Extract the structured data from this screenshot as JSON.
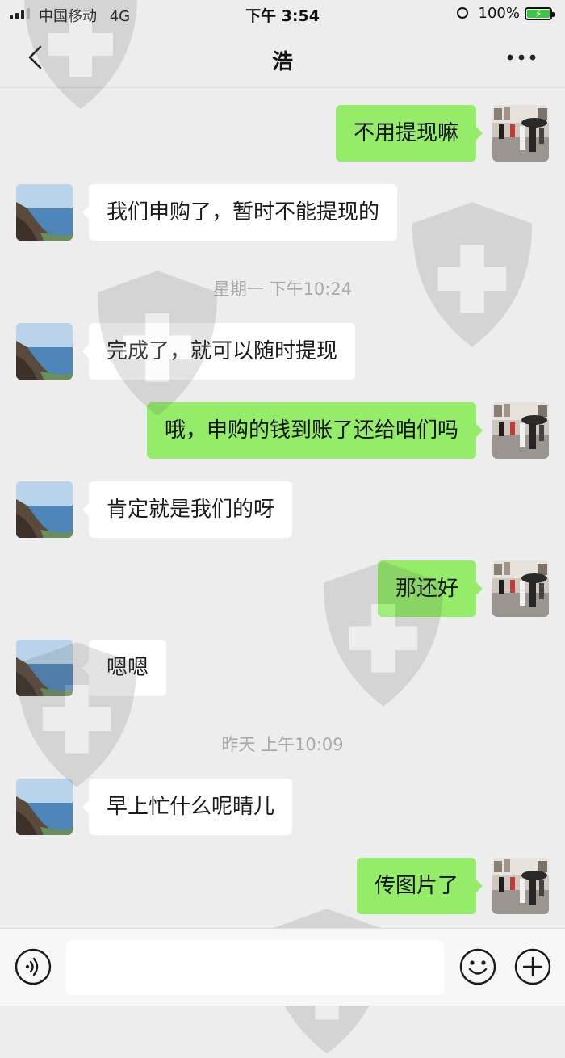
{
  "status_bar": {
    "carrier": "中国移动",
    "network": "4G",
    "time": "下午 3:54",
    "battery": "100%"
  },
  "nav": {
    "title": "浩"
  },
  "messages": [
    {
      "side": "right",
      "text": "不用提现嘛"
    },
    {
      "side": "left",
      "text": "我们申购了，暂时不能提现的"
    },
    {
      "type": "time",
      "text": "星期一 下午10:24"
    },
    {
      "side": "left",
      "text": "完成了，就可以随时提现"
    },
    {
      "side": "right",
      "text": "哦，申购的钱到账了还给咱们吗"
    },
    {
      "side": "left",
      "text": "肯定就是我们的呀"
    },
    {
      "side": "right",
      "text": "那还好"
    },
    {
      "side": "left",
      "text": "嗯嗯"
    },
    {
      "type": "time",
      "text": "昨天 上午10:09"
    },
    {
      "side": "left",
      "text": "早上忙什么呢晴儿"
    },
    {
      "side": "right",
      "text": "传图片了"
    }
  ],
  "input": {
    "placeholder": ""
  },
  "colors": {
    "background": "#ededed",
    "outgoing_bubble": "#95ec69",
    "incoming_bubble": "#ffffff",
    "battery": "#3dc445"
  },
  "icons": [
    "back-chevron-icon",
    "more-dots-icon",
    "voice-icon",
    "emoji-icon",
    "plus-icon"
  ]
}
